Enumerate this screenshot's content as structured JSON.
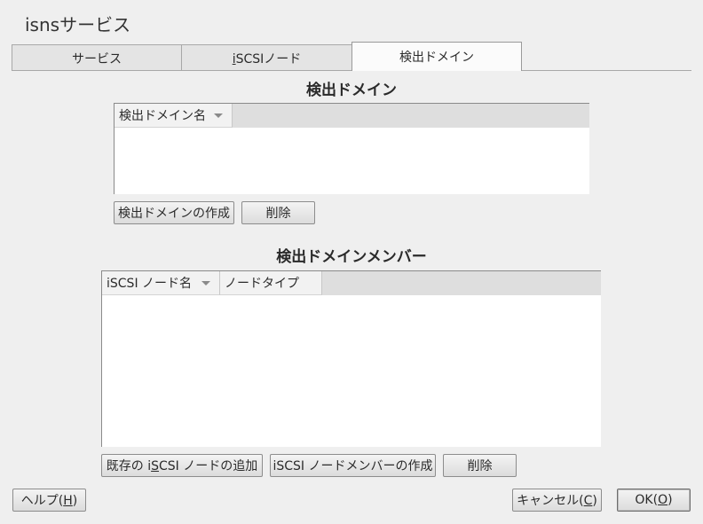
{
  "window": {
    "title": "isnsサービス"
  },
  "tabs": [
    {
      "label": "サービス"
    },
    {
      "label_mnemonic": "i",
      "label_rest": "SCSIノード"
    },
    {
      "label": "検出ドメイン"
    }
  ],
  "discovery_domain": {
    "title": "検出ドメイン",
    "columns": [
      {
        "label": "検出ドメイン名"
      }
    ],
    "buttons": {
      "create": "検出ドメインの作成",
      "delete": "削除"
    }
  },
  "members": {
    "title": "検出ドメインメンバー",
    "columns": [
      {
        "label": "iSCSI ノード名"
      },
      {
        "label": "ノードタイプ"
      }
    ],
    "buttons": {
      "add_existing_pre": "既存の i",
      "add_existing_mnemonic": "S",
      "add_existing_post": "CSI ノードの追加",
      "create_member": "iSCSI ノードメンバーの作成",
      "delete": "削除"
    }
  },
  "footer": {
    "help": {
      "pre": "ヘルプ(",
      "mnemonic": "H",
      "post": ")"
    },
    "cancel": {
      "pre": "キャンセル(",
      "mnemonic": "C",
      "post": ")"
    },
    "ok": {
      "pre": "OK(",
      "mnemonic": "O",
      "post": ")"
    }
  },
  "icons": {
    "sort": "sort-descending-icon"
  }
}
